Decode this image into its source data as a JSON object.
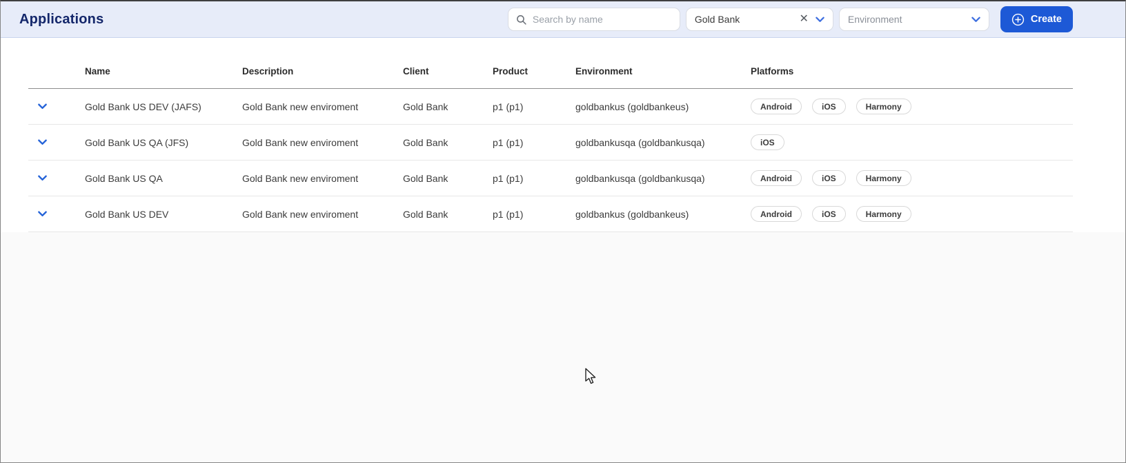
{
  "header": {
    "title": "Applications",
    "search": {
      "placeholder": "Search by name",
      "value": ""
    },
    "client_filter": {
      "value": "Gold Bank"
    },
    "environment_filter": {
      "placeholder": "Environment"
    },
    "create_button": {
      "label": "Create"
    }
  },
  "table": {
    "columns": [
      "Name",
      "Description",
      "Client",
      "Product",
      "Environment",
      "Platforms"
    ],
    "rows": [
      {
        "name": "Gold Bank US DEV (JAFS)",
        "description": "Gold Bank new enviroment",
        "client": "Gold Bank",
        "product": "p1 (p1)",
        "environment": "goldbankus (goldbankeus)",
        "platforms": [
          "Android",
          "iOS",
          "Harmony"
        ]
      },
      {
        "name": "Gold Bank US QA (JFS)",
        "description": "Gold Bank new enviroment",
        "client": "Gold Bank",
        "product": "p1 (p1)",
        "environment": "goldbankusqa (goldbankusqa)",
        "platforms": [
          "iOS"
        ]
      },
      {
        "name": "Gold Bank US QA",
        "description": "Gold Bank new enviroment",
        "client": "Gold Bank",
        "product": "p1 (p1)",
        "environment": "goldbankusqa (goldbankusqa)",
        "platforms": [
          "Android",
          "iOS",
          "Harmony"
        ]
      },
      {
        "name": "Gold Bank US DEV",
        "description": "Gold Bank new enviroment",
        "client": "Gold Bank",
        "product": "p1 (p1)",
        "environment": "goldbankus (goldbankeus)",
        "platforms": [
          "Android",
          "iOS",
          "Harmony"
        ]
      }
    ]
  },
  "colors": {
    "accent_blue": "#1d59d6",
    "chevron_blue": "#3e6fe0",
    "topbar_background": "#e7ecf9",
    "title_navy": "#14276b",
    "page_background": "#fafafa"
  }
}
